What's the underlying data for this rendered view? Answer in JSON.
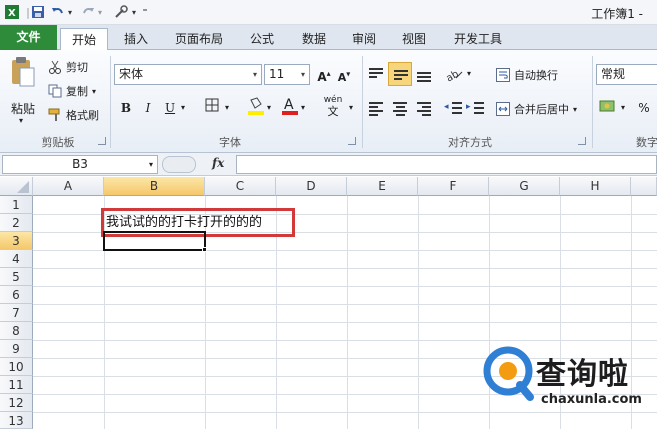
{
  "window": {
    "title": "工作簿1 -"
  },
  "tabs": {
    "file": "文件",
    "home": "开始",
    "insert": "插入",
    "page_layout": "页面布局",
    "formulas": "公式",
    "data": "数据",
    "review": "审阅",
    "view": "视图",
    "developer": "开发工具"
  },
  "clipboard": {
    "label": "剪贴板",
    "paste": "粘贴",
    "cut": "剪切",
    "copy": "复制",
    "format_painter": "格式刷"
  },
  "font": {
    "label": "字体",
    "name": "宋体",
    "size": "11",
    "bold": "B",
    "italic": "I",
    "underline": "U",
    "phonetic": "wén"
  },
  "alignment": {
    "label": "对齐方式",
    "wrap_text": "自动换行",
    "merge_center": "合并后居中"
  },
  "number": {
    "label": "数字",
    "format": "常规",
    "percent": "%"
  },
  "formula_bar": {
    "name_box": "B3",
    "fx": "fx",
    "formula": ""
  },
  "sheet": {
    "columns": [
      "A",
      "B",
      "C",
      "D",
      "E",
      "F",
      "G",
      "H"
    ],
    "rows": [
      "1",
      "2",
      "3",
      "4",
      "5",
      "6",
      "7",
      "8",
      "9",
      "10",
      "11",
      "12",
      "13"
    ],
    "selected_cell": "B3",
    "cells": {
      "B2": "我试试的的打卡打开的的的"
    }
  },
  "watermark": {
    "text": "查询啦",
    "url": "chaxunla.com"
  },
  "colors": {
    "file_tab": "#2d8b3a",
    "highlight_box": "#d23a3a",
    "selected_header": "#f5c76b",
    "watermark_blue": "#2f7fd4",
    "watermark_orange": "#f39c12"
  }
}
